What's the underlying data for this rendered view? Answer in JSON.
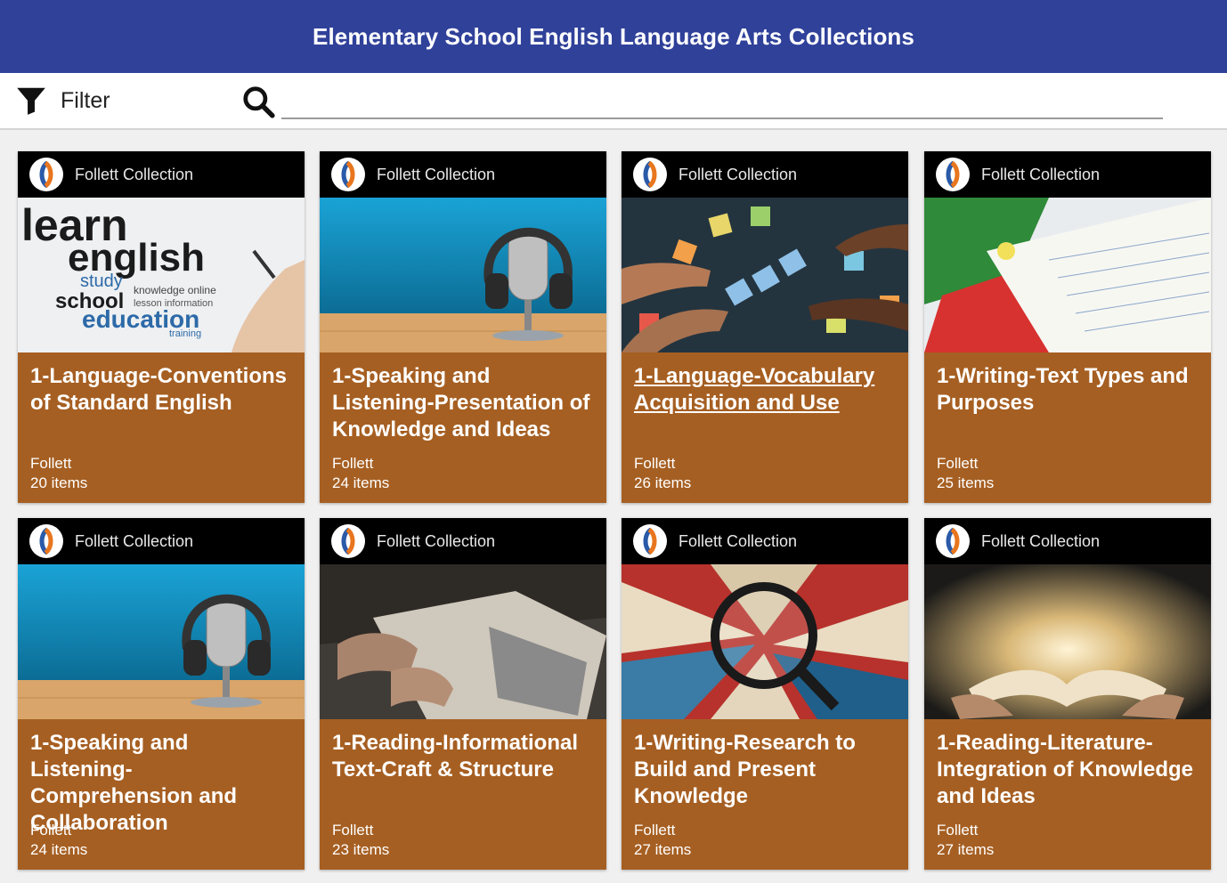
{
  "header": {
    "title": "Elementary School English Language Arts Collections"
  },
  "toolbar": {
    "filter_label": "Filter",
    "search_value": ""
  },
  "cards": [
    {
      "source": "Follett Collection",
      "title": "1-Language-Conventions of Standard English",
      "publisher": "Follett",
      "count": "20 items",
      "image": "word-cloud",
      "underlined": false
    },
    {
      "source": "Follett Collection",
      "title": "1-Speaking and Listening-Presentation of Knowledge and Ideas",
      "publisher": "Follett",
      "count": "24 items",
      "image": "microphone-headphones",
      "underlined": false
    },
    {
      "source": "Follett Collection",
      "title": "1-Language-Vocabulary Acquisition and Use",
      "publisher": "Follett",
      "count": "26 items",
      "image": "letter-blocks",
      "underlined": true
    },
    {
      "source": "Follett Collection",
      "title": "1-Writing-Text Types and Purposes",
      "publisher": "Follett",
      "count": "25 items",
      "image": "reading-notebook",
      "underlined": false
    },
    {
      "source": "Follett Collection",
      "title": "1-Speaking and Listening-Comprehension and Collaboration",
      "publisher": "Follett",
      "count": "24 items",
      "image": "microphone-headphones",
      "underlined": false
    },
    {
      "source": "Follett Collection",
      "title": "1-Reading-Informational Text-Craft & Structure",
      "publisher": "Follett",
      "count": "23 items",
      "image": "hands-reading-book",
      "underlined": false
    },
    {
      "source": "Follett Collection",
      "title": "1-Writing-Research to Build and Present Knowledge",
      "publisher": "Follett",
      "count": "27 items",
      "image": "books-magnifier",
      "underlined": false
    },
    {
      "source": "Follett Collection",
      "title": "1-Reading-Literature-Integration of Knowledge and Ideas",
      "publisher": "Follett",
      "count": "27 items",
      "image": "glowing-book",
      "underlined": false
    }
  ],
  "colors": {
    "header_bg": "#30419a",
    "card_bg": "#a65f22",
    "card_header_bg": "#000000",
    "logo_blue": "#2a5aa8",
    "logo_orange": "#e8761e"
  }
}
